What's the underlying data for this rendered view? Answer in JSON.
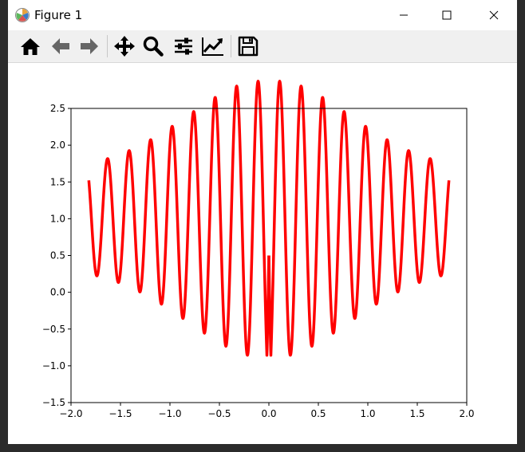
{
  "window": {
    "title": "Figure 1",
    "icons": {
      "app": "matplotlib-icon",
      "minimize": "minimize-icon",
      "maximize": "maximize-icon",
      "close": "close-icon"
    }
  },
  "toolbar": {
    "buttons": [
      {
        "name": "home",
        "icon": "home-icon"
      },
      {
        "name": "back",
        "icon": "arrow-left-icon"
      },
      {
        "name": "forward",
        "icon": "arrow-right-icon"
      },
      {
        "name": "pan",
        "icon": "move-icon"
      },
      {
        "name": "zoom",
        "icon": "magnifier-icon"
      },
      {
        "name": "subplots",
        "icon": "sliders-icon"
      },
      {
        "name": "edit-axis",
        "icon": "chart-line-icon"
      },
      {
        "name": "save",
        "icon": "floppy-disk-icon"
      }
    ]
  },
  "colors": {
    "line": "#ff0000",
    "axes": "#000000",
    "toolbar_bg": "#f0f0f0",
    "figure_bg": "#ffffff"
  },
  "chart_data": {
    "type": "line",
    "series": [
      {
        "color": "#ff0000",
        "sampled": {
          "x": [
            -1.8,
            -1.7,
            -1.65,
            -1.6,
            -1.55,
            -1.5,
            -1.45,
            -1.35,
            -1.3,
            -1.2,
            -1.15,
            -1.05,
            -1.0,
            -0.9,
            -0.85,
            -0.75,
            -0.7,
            -0.6,
            -0.55,
            -0.45,
            -0.4,
            -0.3,
            -0.25,
            -0.17,
            -0.08,
            0.0,
            0.05,
            0.1,
            0.2,
            0.3,
            0.4,
            0.5,
            0.55,
            0.65,
            0.75,
            0.8,
            0.9,
            1.0,
            1.05,
            1.15,
            1.25,
            1.3,
            1.4,
            1.5,
            1.55,
            1.6,
            1.7,
            1.8
          ],
          "y": [
            1.6,
            0.9,
            1.5,
            2.15,
            1.2,
            0.4,
            1.4,
            2.3,
            0.5,
            2.35,
            -0.3,
            2.35,
            -0.55,
            2.3,
            -0.8,
            2.2,
            -1.05,
            2.0,
            -1.3,
            1.8,
            1.55,
            -1.3,
            -0.5,
            1.5,
            2.15,
            1.2,
            0.4,
            -0.8,
            2.3,
            -0.3,
            2.35,
            0.4,
            1.1,
            2.35,
            0.5,
            2.3,
            0.4,
            2.35,
            1.2,
            0.9,
            2.2,
            1.5,
            0.4,
            2.15,
            1.2,
            0.9,
            1.5,
            1.55
          ]
        },
        "approx_function": "|x| * sin(2πx·7.5) + 1.5 with amplitude increasing toward the center (interference pattern)"
      }
    ],
    "xlim": [
      -2.0,
      2.0
    ],
    "ylim": [
      -1.5,
      2.5
    ],
    "xticks": [
      -2.0,
      -1.5,
      -1.0,
      -0.5,
      0.0,
      0.5,
      1.0,
      1.5,
      2.0
    ],
    "xtick_labels": [
      "−2.0",
      "−1.5",
      "−1.0",
      "−0.5",
      "0.0",
      "0.5",
      "1.0",
      "1.5",
      "2.0"
    ],
    "yticks": [
      -1.5,
      -1.0,
      -0.5,
      0.0,
      0.5,
      1.0,
      1.5,
      2.0,
      2.5
    ],
    "ytick_labels": [
      "−1.5",
      "−1.0",
      "−0.5",
      "0.0",
      "0.5",
      "1.0",
      "1.5",
      "2.0",
      "2.5"
    ],
    "grid": false,
    "title": "",
    "xlabel": "",
    "ylabel": ""
  }
}
